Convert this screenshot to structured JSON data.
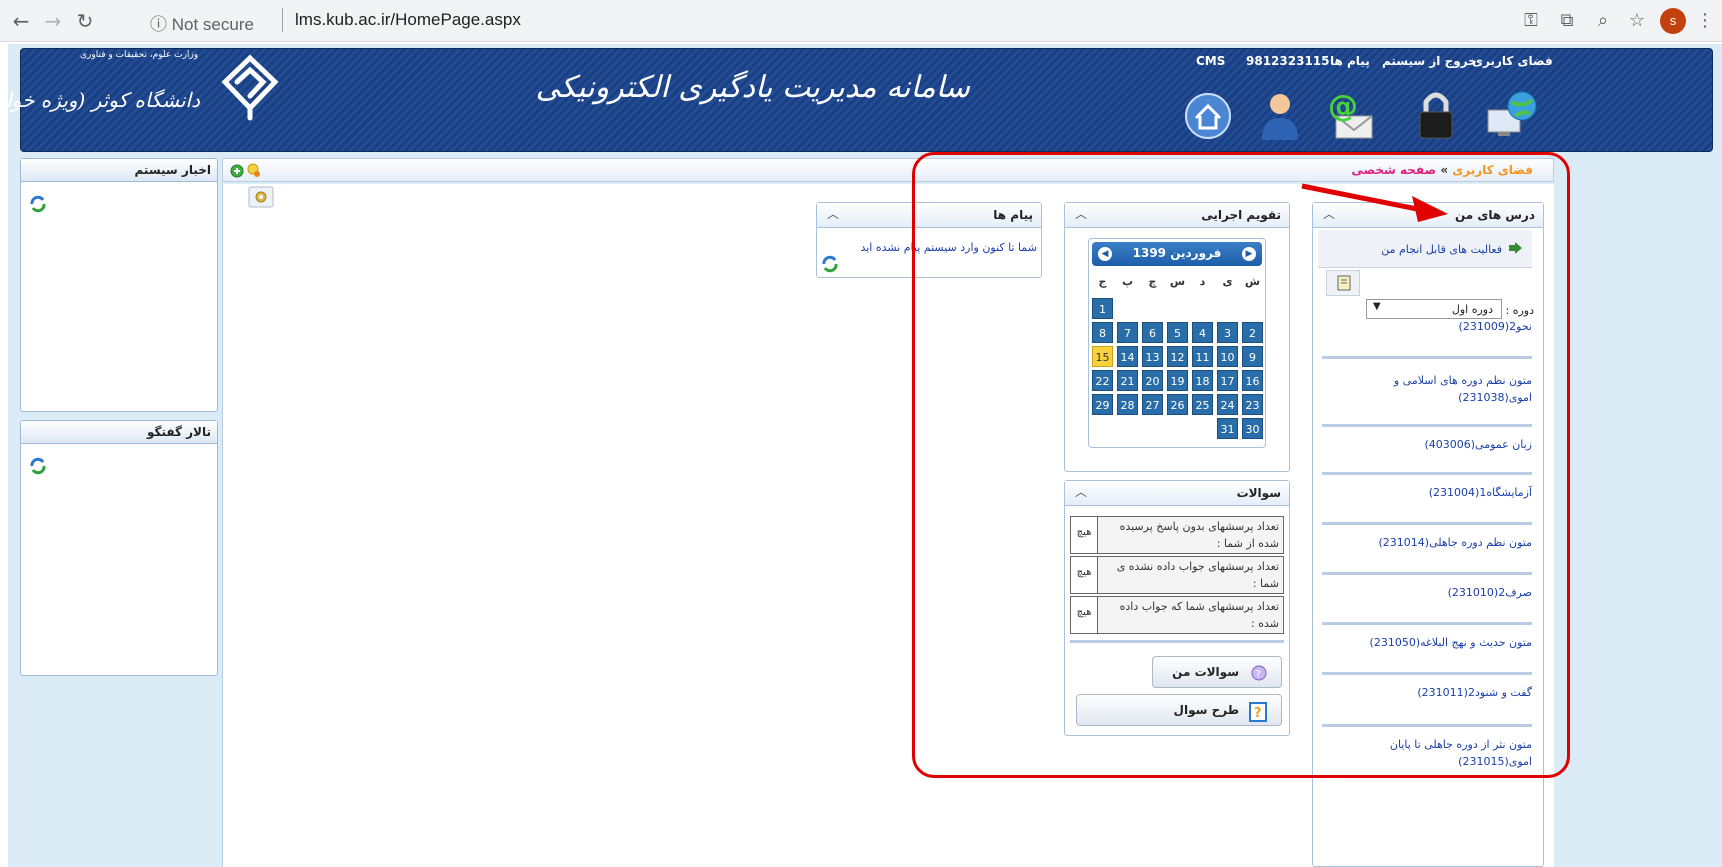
{
  "browser": {
    "security": "Not secure",
    "url": "lms.kub.ac.ir/HomePage.aspx",
    "avatar_letter": "s"
  },
  "header": {
    "title": "سامانه مدیریت یادگیری الکترونیکی",
    "university": "دانشگاه کوثر (ویژه خواهران)",
    "ministry": "وزارت علوم، تحقیقات و فناوری",
    "links": {
      "user_space": "فضای کاربری",
      "logout": "خروج از سیستم",
      "messages": "پیام ها",
      "user_id": "9812323115",
      "cms": "CMS"
    }
  },
  "breadcrumb": {
    "root": "فضای کاربری",
    "separator": "»",
    "current": "صفحه شخصی"
  },
  "left": {
    "news_title": "اخبار سیستم",
    "forum_title": "تالار گفتگو"
  },
  "courses": {
    "title": "درس های من",
    "activities": "فعالیت های قابل انجام من",
    "term_label": "دوره :",
    "term_value": "دوره اول",
    "items": [
      "نحو2(231009)",
      "متون نظم دوره های اسلامی و اموی(231038)",
      "زبان عمومی(403006)",
      "آزمایشگاه1(231004)",
      "متون نظم دوره جاهلی(231014)",
      "صرف2(231010)",
      "متون حدیث و نهج البلاغه(231050)",
      "گفت و شنود2(231011)",
      "متون نثر از دوره جاهلی تا پایان اموی(231015)"
    ]
  },
  "calendar": {
    "title": "تقویم اجرایی",
    "month": "فروردین 1399",
    "weekdays": [
      "ش",
      "ی",
      "د",
      "س",
      "چ",
      "پ",
      "ج"
    ],
    "today": "15",
    "days": [
      "1",
      "2",
      "3",
      "4",
      "5",
      "6",
      "7",
      "8",
      "9",
      "10",
      "11",
      "12",
      "13",
      "14",
      "15",
      "16",
      "17",
      "18",
      "19",
      "20",
      "21",
      "22",
      "23",
      "24",
      "25",
      "26",
      "27",
      "28",
      "29",
      "30",
      "31"
    ]
  },
  "messages": {
    "title": "پیام ها",
    "empty": "شما تا کنون وارد سیستم پیام نشده اید"
  },
  "questions": {
    "title": "سوالات",
    "rows": [
      {
        "label": "تعداد پرسشهای بدون پاسخ پرسیده شده از شما :",
        "value": "هیچ"
      },
      {
        "label": "تعداد پرسشهای جواب داده نشده ی شما :",
        "value": "هیچ"
      },
      {
        "label": "تعداد پرسشهای شما که جواب داده شده :",
        "value": "هیچ"
      }
    ],
    "my_questions": "سوالات من",
    "ask_question": "طرح سوال"
  },
  "colors": {
    "header_blue": "#1a3f82",
    "calendar_day": "#2a6ea9",
    "today": "#f7d23e",
    "highlight": "#e00000"
  }
}
